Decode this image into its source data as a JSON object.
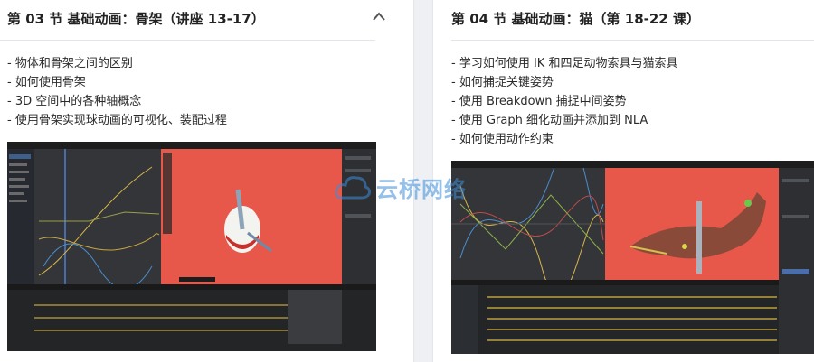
{
  "left_card": {
    "title": "第 03 节 基础动画：骨架（讲座 13-17）",
    "bullets": [
      "- 物体和骨架之间的区别",
      "- 如何使用骨架",
      "- 3D 空间中的各种轴概念",
      "- 使用骨架实现球动画的可视化、装配过程"
    ]
  },
  "right_card": {
    "title": "第 04 节 基础动画：猫（第 18-22 课）",
    "bullets": [
      "- 学习如何使用 IK 和四足动物索具与猫索具",
      "- 如何捕捉关键姿势",
      "- 使用 Breakdown 捕捉中间姿势",
      "- 使用 Graph 细化动画并添加到 NLA",
      "- 如何使用动作约束"
    ]
  },
  "watermark": {
    "text": "云桥网络",
    "color": "#3d8ed8"
  },
  "colors": {
    "viewport_red": "#e8584a",
    "editor_dark": "#2b2b2b",
    "accent_blue": "#4a90d9"
  }
}
